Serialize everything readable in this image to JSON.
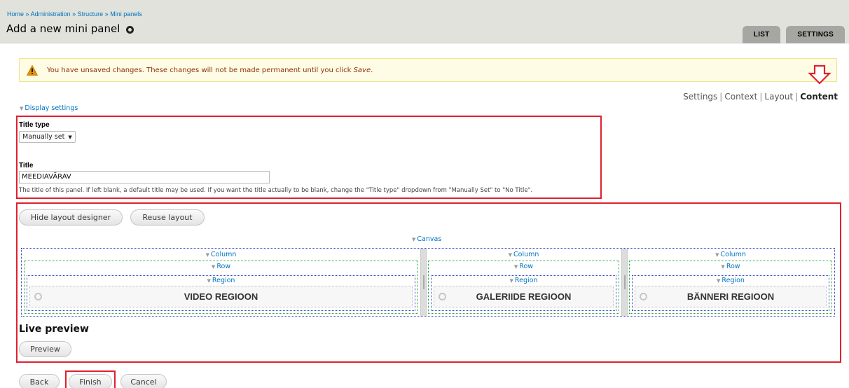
{
  "breadcrumb": {
    "items": [
      "Home",
      "Administration",
      "Structure",
      "Mini panels"
    ],
    "separator": "»"
  },
  "page": {
    "title": "Add a new mini panel"
  },
  "tabs": [
    {
      "label": "LIST"
    },
    {
      "label": "SETTINGS"
    }
  ],
  "message": {
    "text": "You have unsaved changes. These changes will not be made permanent until you click",
    "emphasis": "Save",
    "tail": "."
  },
  "steps": {
    "items": [
      "Settings",
      "Context",
      "Layout",
      "Content"
    ],
    "separator": "|",
    "current": "Content"
  },
  "display_settings": {
    "label": "Display settings"
  },
  "form": {
    "title_type_label": "Title type",
    "title_type_value": "Manually set",
    "title_label": "Title",
    "title_value": "MEEDIAVÄRAV",
    "help": "The title of this panel. If left blank, a default title may be used. If you want the title actually to be blank, change the \"Title type\" dropdown from \"Manually Set\" to \"No Title\"."
  },
  "layout_buttons": {
    "hide": "Hide layout designer",
    "reuse": "Reuse layout"
  },
  "canvas": {
    "label": "Canvas",
    "columns": [
      {
        "column_label": "Column",
        "row_label": "Row",
        "region_label": "Region",
        "pane_title": "VIDEO REGIOON"
      },
      {
        "column_label": "Column",
        "row_label": "Row",
        "region_label": "Region",
        "pane_title": "GALERIIDE REGIOON"
      },
      {
        "column_label": "Column",
        "row_label": "Row",
        "region_label": "Region",
        "pane_title": "BÄNNERI REGIOON"
      }
    ]
  },
  "live_preview": {
    "title": "Live preview",
    "button": "Preview"
  },
  "footer": {
    "back": "Back",
    "finish": "Finish",
    "cancel": "Cancel"
  },
  "colors": {
    "link": "#0074bd",
    "annotation": "#e0202e",
    "warning_bg": "#fffce5",
    "header_bg": "#e1e2dc"
  }
}
